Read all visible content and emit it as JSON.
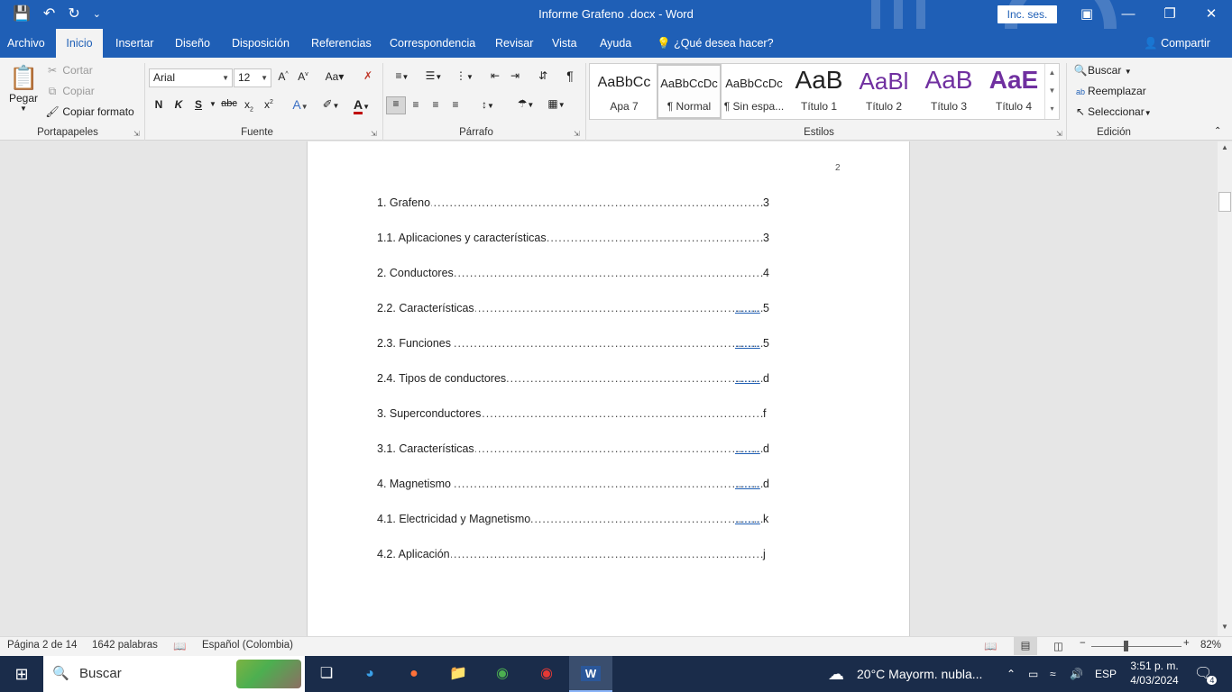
{
  "titlebar": {
    "title": "Informe Grafeno .docx  -  Word",
    "sign_in": "Inc. ses."
  },
  "menu": {
    "tabs": [
      "Archivo",
      "Inicio",
      "Insertar",
      "Diseño",
      "Disposición",
      "Referencias",
      "Correspondencia",
      "Revisar",
      "Vista",
      "Ayuda"
    ],
    "active_tab": "Inicio",
    "tell_me": "¿Qué desea hacer?",
    "share": "Compartir"
  },
  "clipboard": {
    "paste": "Pegar",
    "cut": "Cortar",
    "copy": "Copiar",
    "format_painter": "Copiar formato",
    "group": "Portapapeles"
  },
  "font": {
    "name": "Arial",
    "size": "12",
    "group": "Fuente",
    "bold": "N",
    "italic": "K",
    "underline": "S"
  },
  "paragraph": {
    "group": "Párrafo"
  },
  "styles": {
    "group": "Estilos",
    "items": [
      {
        "preview": "AaBbCc",
        "name": "Apa 7"
      },
      {
        "preview": "AaBbCcDc",
        "name": "¶ Normal"
      },
      {
        "preview": "AaBbCcDc",
        "name": "¶ Sin espa..."
      },
      {
        "preview": "AaB",
        "name": "Título 1"
      },
      {
        "preview": "AaBl",
        "name": "Título 2"
      },
      {
        "preview": "AaB",
        "name": "Título 3"
      },
      {
        "preview": "AaE",
        "name": "Título 4"
      }
    ],
    "heading_color": "#7030a0"
  },
  "editing": {
    "group": "Edición",
    "find": "Buscar",
    "replace": "Reemplazar",
    "select": "Seleccionar"
  },
  "document": {
    "page_number": "2",
    "toc": [
      {
        "label": "1. Grafeno",
        "link": "",
        "page": "3"
      },
      {
        "label": "1.1. Aplicaciones y características",
        "link": "",
        "page": "3"
      },
      {
        "label": "2. Conductores",
        "link": "",
        "page": "4"
      },
      {
        "label": "2.2. Características",
        "link": "........",
        "page": "5"
      },
      {
        "label": "2.3. Funciones",
        "link": "........",
        "page": "5"
      },
      {
        "label": "2.4. Tipos de conductores",
        "link": "........",
        "page": "d"
      },
      {
        "label": "3. Superconductores",
        "link": "",
        "page": "f"
      },
      {
        "label": "3.1. Características",
        "link": "........",
        "page": "d"
      },
      {
        "label": "4. Magnetismo",
        "link": "........",
        "page": "d"
      },
      {
        "label": "4.1. Electricidad y Magnetismo",
        "link": "........",
        "page": "k"
      },
      {
        "label": "4.2. Aplicación",
        "link": "",
        "page": "j"
      }
    ]
  },
  "status": {
    "page": "Página 2 de 14",
    "words": "1642 palabras",
    "language": "Español (Colombia)",
    "zoom": "82%"
  },
  "taskbar": {
    "search": "Buscar",
    "weather": "20°C  Mayorm. nubla...",
    "lang": "ESP",
    "time": "3:51 p. m.",
    "date": "4/03/2024",
    "notifications": "4"
  },
  "colors": {
    "word_blue": "#1f5fb6",
    "taskbar": "#1a2c4a"
  }
}
